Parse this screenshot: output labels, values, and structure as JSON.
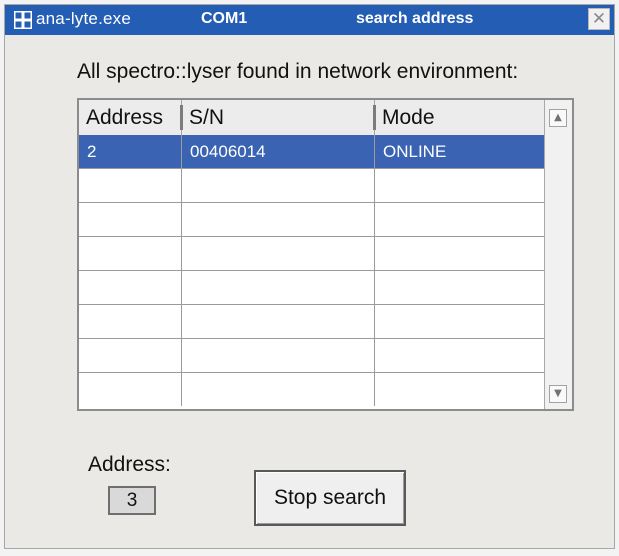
{
  "window": {
    "app_name": "ana-lyte.exe",
    "port": "COM1",
    "title": "search address",
    "close_symbol": "✕",
    "title_bar_color": "#235db4"
  },
  "heading": "All spectro::lyser found in network environment:",
  "table": {
    "columns": [
      "Address",
      "S/N",
      "Mode"
    ],
    "rows": [
      {
        "address": "2",
        "serial": "00406014",
        "mode": "ONLINE",
        "selected": true
      },
      {
        "address": "",
        "serial": "",
        "mode": "",
        "selected": false
      },
      {
        "address": "",
        "serial": "",
        "mode": "",
        "selected": false
      },
      {
        "address": "",
        "serial": "",
        "mode": "",
        "selected": false
      },
      {
        "address": "",
        "serial": "",
        "mode": "",
        "selected": false
      },
      {
        "address": "",
        "serial": "",
        "mode": "",
        "selected": false
      },
      {
        "address": "",
        "serial": "",
        "mode": "",
        "selected": false
      },
      {
        "address": "",
        "serial": "",
        "mode": "",
        "selected": false
      }
    ],
    "selected_row_color": "#3b63b3",
    "scroll_up_symbol": "▲",
    "scroll_down_symbol": "▼"
  },
  "address": {
    "label": "Address:",
    "value": "3"
  },
  "stop_button": {
    "label": "Stop search"
  }
}
